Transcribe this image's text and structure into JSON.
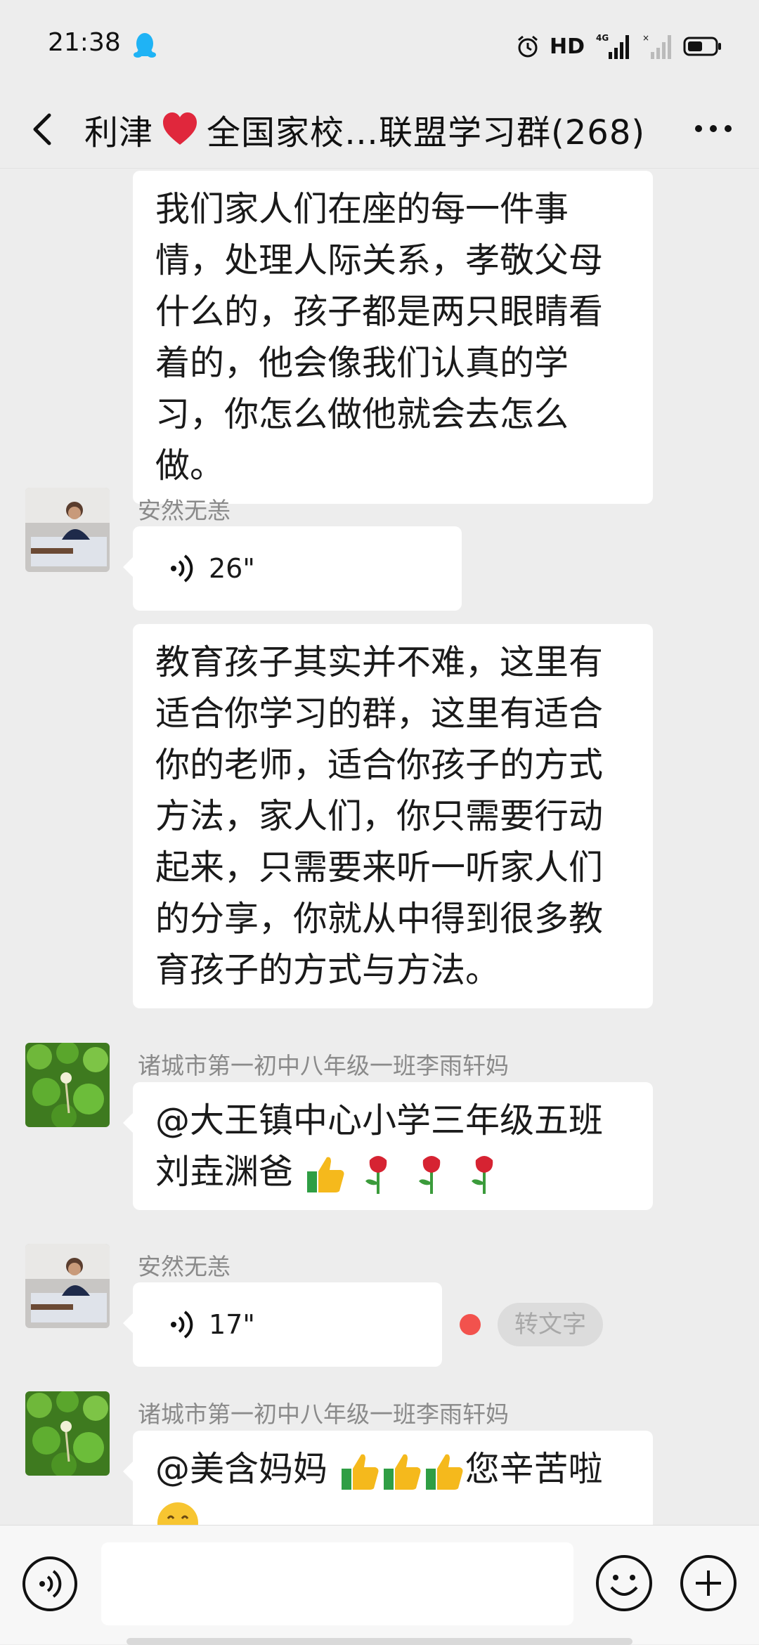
{
  "status": {
    "time": "21:38",
    "hd": "HD",
    "network": "4G"
  },
  "header": {
    "title_prefix": "利津",
    "title_suffix": "全国家校…联盟学习群(268)"
  },
  "messages": [
    {
      "type": "text",
      "text": "我们家人们在座的每一件事情，处理人际关系，孝敬父母什么的，孩子都是两只眼睛看着的，他会像我们认真的学习，你怎么做他就会去怎么做。"
    },
    {
      "type": "voice",
      "sender": "安然无恙",
      "duration": "26\""
    },
    {
      "type": "text",
      "text": "教育孩子其实并不难，这里有适合你学习的群，这里有适合你的老师，适合你孩子的方式方法，家人们，你只需要行动起来，只需要来听一听家人们的分享，你就从中得到很多教育孩子的方式与方法。"
    },
    {
      "type": "text",
      "sender": "诸城市第一初中八年级一班李雨轩妈",
      "text": "@大王镇中心小学三年级五班刘垚渊爸"
    },
    {
      "type": "voice",
      "sender": "安然无恙",
      "duration": "17\"",
      "convert_label": "转文字"
    },
    {
      "type": "text",
      "sender": "诸城市第一初中八年级一班李雨轩妈",
      "text_prefix": "@美含妈妈",
      "text_suffix": "您辛苦啦"
    }
  ],
  "colors": {
    "background": "#ededed",
    "bubble": "#ffffff",
    "unread": "#f2524d"
  }
}
